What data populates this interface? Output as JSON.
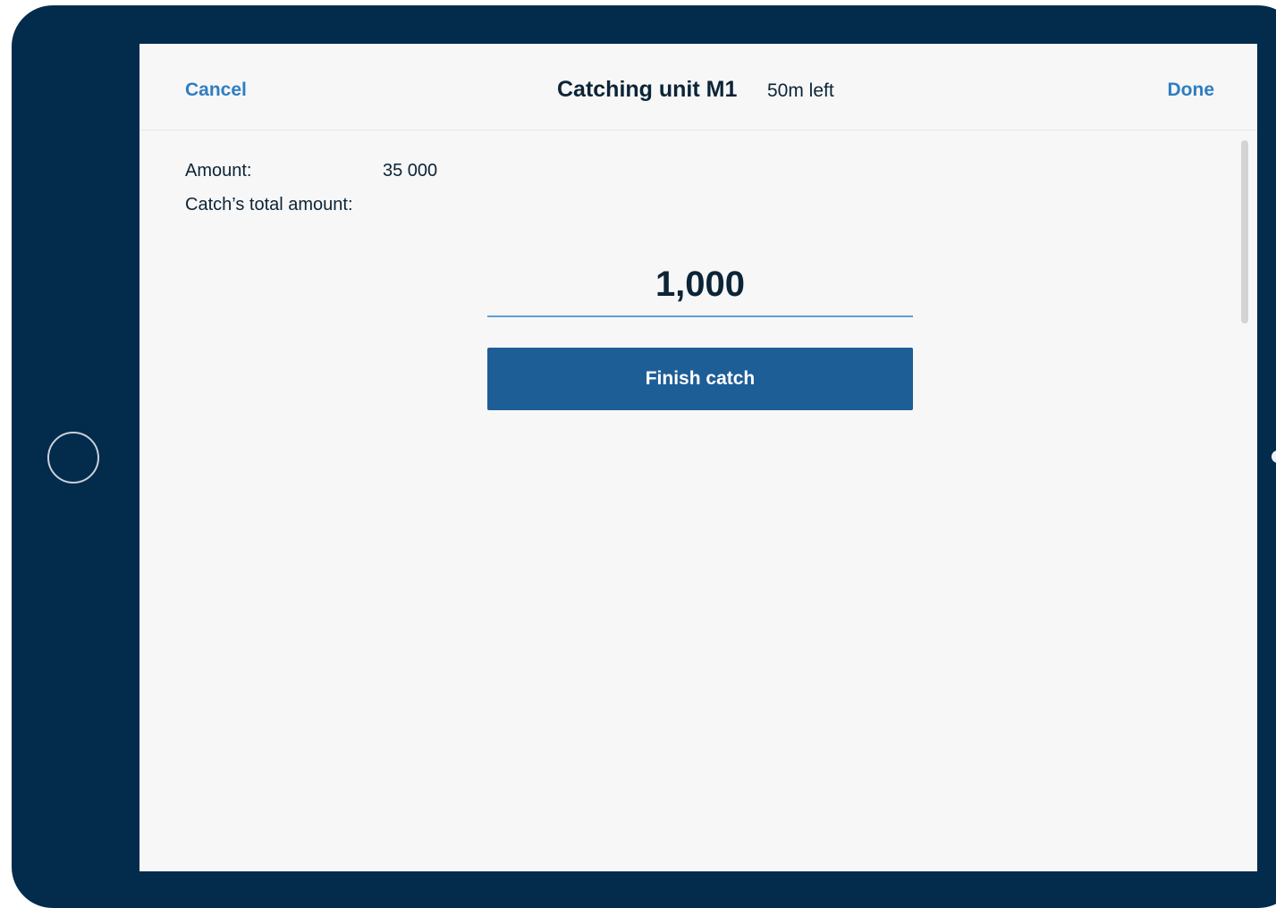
{
  "header": {
    "cancel_label": "Cancel",
    "title": "Catching unit M1",
    "time_left": "50m left",
    "done_label": "Done"
  },
  "form": {
    "amount_label": "Amount:",
    "amount_value": "35 000",
    "total_label": "Catch’s total amount:",
    "quantity_value": "1,000",
    "finish_button_label": "Finish catch"
  },
  "colors": {
    "device_frame": "#022b4c",
    "accent": "#2f7ec0",
    "primary_button": "#1e5e97",
    "screen_background": "#f7f7f7"
  }
}
